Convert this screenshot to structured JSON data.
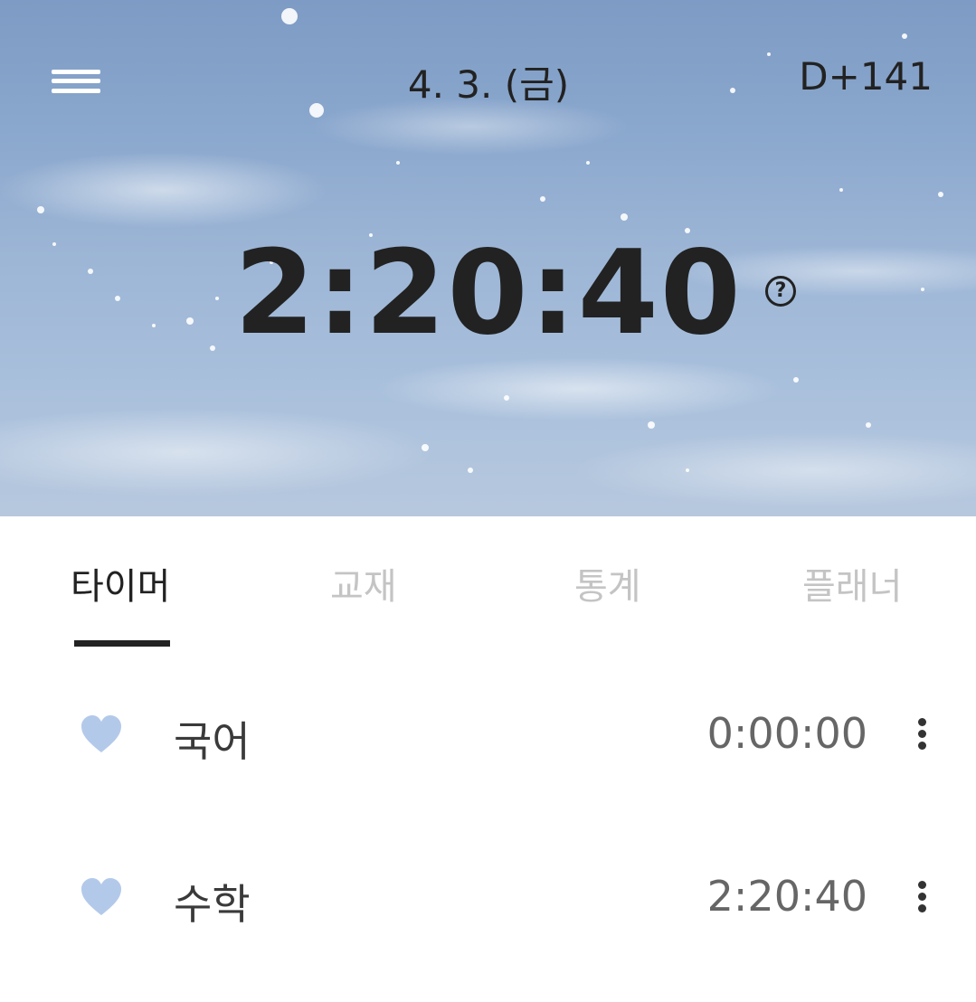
{
  "header": {
    "menu_icon": "hamburger-menu-icon",
    "date": "4. 3. (금)",
    "dday": "D+141",
    "total_time": "2:20:40",
    "help_icon": "question-circle-icon",
    "help_glyph": "?"
  },
  "tabs": [
    {
      "label": "타이머",
      "active": true
    },
    {
      "label": "교재",
      "active": false
    },
    {
      "label": "통계",
      "active": false
    },
    {
      "label": "플래너",
      "active": false
    }
  ],
  "subjects": [
    {
      "name": "국어",
      "time": "0:00:00",
      "icon": "heart-icon",
      "color": "#b3c9ea"
    },
    {
      "name": "수학",
      "time": "2:20:40",
      "icon": "heart-icon",
      "color": "#b3c9ea"
    }
  ],
  "colors": {
    "accent": "#222222",
    "inactive_tab": "#c4c4c4",
    "heart": "#b3c9ea"
  }
}
